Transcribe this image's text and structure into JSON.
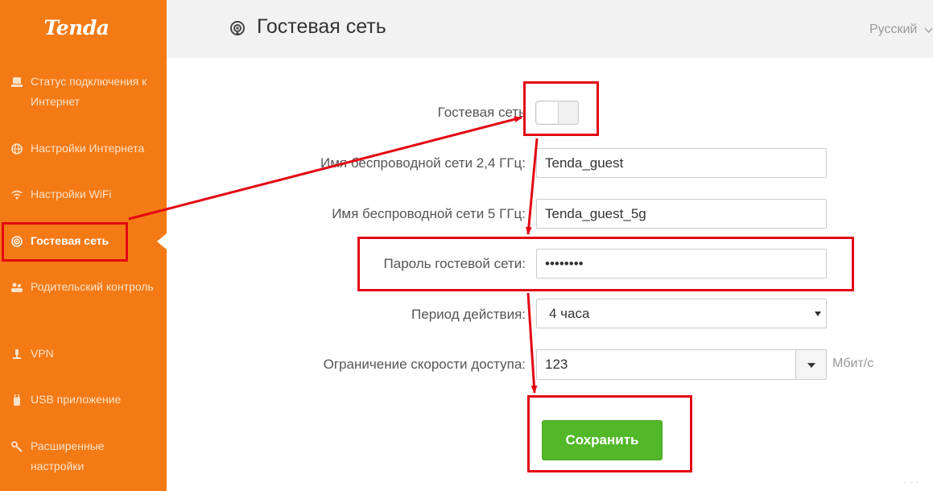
{
  "app": {
    "logo_text": "Tenda"
  },
  "sidebar": {
    "items": [
      {
        "label": "Статус подключения к Интернет",
        "icon": "connection-status-icon"
      },
      {
        "label": "Настройки Интернета",
        "icon": "globe-icon"
      },
      {
        "label": "Настройки WiFi",
        "icon": "wifi-icon"
      },
      {
        "label": "Гостевая сеть",
        "icon": "guest-network-icon",
        "active": true
      },
      {
        "label": "Родительский контроль",
        "icon": "parental-control-icon"
      },
      {
        "label": "VPN",
        "icon": "vpn-icon"
      },
      {
        "label": "USB приложение",
        "icon": "usb-icon"
      },
      {
        "label": "Расширенные настройки",
        "icon": "wrench-icon"
      }
    ]
  },
  "header": {
    "title": "Гостевая сеть",
    "title_icon": "guest-network-icon",
    "language": "Русский"
  },
  "form": {
    "guest_network": {
      "label": "Гостевая сеть",
      "enabled": false
    },
    "ssid_24": {
      "label": "Имя беспроводной сети 2,4 ГГц:",
      "value": "Tenda_guest"
    },
    "ssid_5": {
      "label": "Имя беспроводной сети 5 ГГц:",
      "value": "Tenda_guest_5g"
    },
    "password": {
      "label": "Пароль гостевой сети:",
      "value": "12345678"
    },
    "period": {
      "label": "Период действия:",
      "value": "4 часа"
    },
    "speed_limit": {
      "label": "Ограничение скорости доступа:",
      "value": "123",
      "unit": "Мбит/с"
    },
    "save_label": "Сохранить"
  },
  "annotations": {
    "highlight_color": "#e30613"
  },
  "colors": {
    "sidebar": "#f47a16",
    "save_button": "#52b829",
    "topbar": "#f2f2f2"
  }
}
